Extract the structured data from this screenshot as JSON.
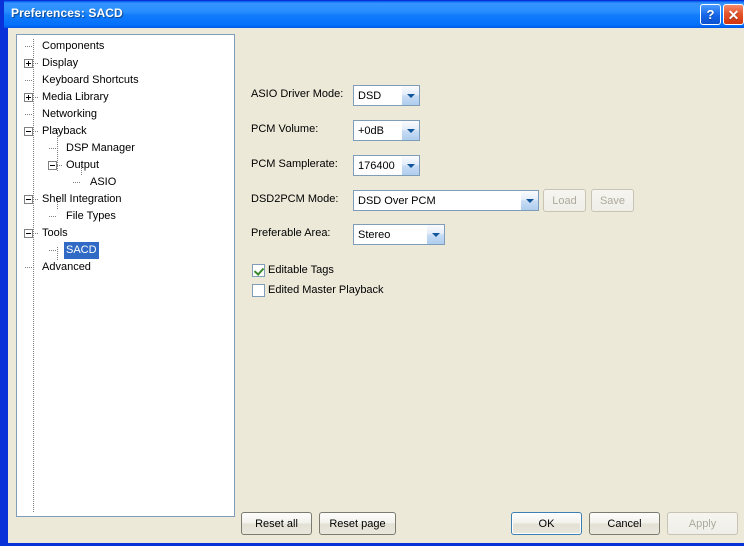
{
  "window": {
    "title": "Preferences: SACD",
    "help_button": "?",
    "close_button": "✕"
  },
  "sidebar": {
    "items": [
      {
        "label": "Components",
        "depth": 1,
        "expander": "none"
      },
      {
        "label": "Display",
        "depth": 1,
        "expander": "plus"
      },
      {
        "label": "Keyboard Shortcuts",
        "depth": 1,
        "expander": "none"
      },
      {
        "label": "Media Library",
        "depth": 1,
        "expander": "plus"
      },
      {
        "label": "Networking",
        "depth": 1,
        "expander": "none"
      },
      {
        "label": "Playback",
        "depth": 1,
        "expander": "minus"
      },
      {
        "label": "DSP Manager",
        "depth": 2,
        "expander": "none"
      },
      {
        "label": "Output",
        "depth": 2,
        "expander": "minus"
      },
      {
        "label": "ASIO",
        "depth": 3,
        "expander": "none"
      },
      {
        "label": "Shell Integration",
        "depth": 1,
        "expander": "minus"
      },
      {
        "label": "File Types",
        "depth": 2,
        "expander": "none"
      },
      {
        "label": "Tools",
        "depth": 1,
        "expander": "minus"
      },
      {
        "label": "SACD",
        "depth": 2,
        "expander": "none",
        "selected": true
      },
      {
        "label": "Advanced",
        "depth": 1,
        "expander": "none"
      }
    ]
  },
  "main": {
    "fields": [
      {
        "label": "ASIO Driver Mode:",
        "value": "DSD"
      },
      {
        "label": "PCM Volume:",
        "value": "+0dB"
      },
      {
        "label": "PCM Samplerate:",
        "value": "176400"
      },
      {
        "label": "DSD2PCM Mode:",
        "value": "DSD Over PCM"
      },
      {
        "label": "Preferable Area:",
        "value": "Stereo"
      }
    ],
    "load_label": "Load",
    "save_label": "Save",
    "checkboxes": [
      {
        "label": "Editable Tags",
        "checked": true
      },
      {
        "label": "Edited Master Playback",
        "checked": false
      }
    ]
  },
  "footer": {
    "reset_all": "Reset all",
    "reset_page": "Reset page",
    "ok": "OK",
    "cancel": "Cancel",
    "apply": "Apply"
  },
  "colors": {
    "titlebar_blue": "#0058ee",
    "dialog_bg": "#ece9d8",
    "selection_blue": "#316ac5",
    "close_red": "#d3340d"
  }
}
